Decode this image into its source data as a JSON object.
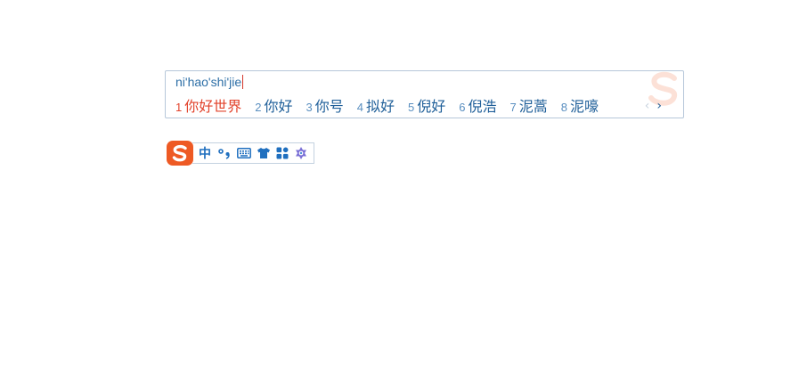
{
  "composition": {
    "text": "ni'hao'shi'jie"
  },
  "candidates": [
    {
      "num": "1",
      "text": "你好世界",
      "active": true
    },
    {
      "num": "2",
      "text": "你好",
      "active": false
    },
    {
      "num": "3",
      "text": "你号",
      "active": false
    },
    {
      "num": "4",
      "text": "拟好",
      "active": false
    },
    {
      "num": "5",
      "text": "倪好",
      "active": false
    },
    {
      "num": "6",
      "text": "倪浩",
      "active": false
    },
    {
      "num": "7",
      "text": "泥蒿",
      "active": false
    },
    {
      "num": "8",
      "text": "泥嚎",
      "active": false
    }
  ],
  "pager": {
    "prev": "‹",
    "next": "›"
  },
  "status_bar": {
    "mode_label": "中",
    "tools": [
      "punctuation-icon",
      "keyboard-icon",
      "skin-icon",
      "toolbox-icon",
      "settings-icon"
    ]
  },
  "colors": {
    "accent_blue": "#1f6fbf",
    "active_red": "#e2432c",
    "logo_orange": "#ee5a24",
    "border": "#b6c7d9"
  }
}
